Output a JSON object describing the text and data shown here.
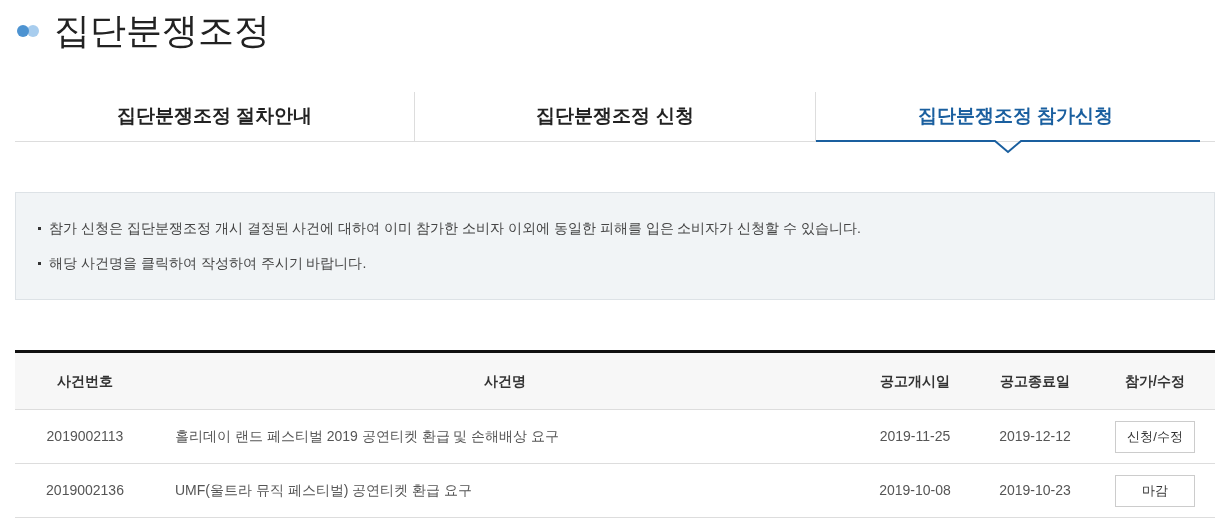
{
  "title": "집단분쟁조정",
  "tabs": [
    {
      "label": "집단분쟁조정 절차안내",
      "selected": false
    },
    {
      "label": "집단분쟁조정 신청",
      "selected": false
    },
    {
      "label": "집단분쟁조정 참가신청",
      "selected": true
    }
  ],
  "notices": [
    "참가 신청은 집단분쟁조정 개시 결정된 사건에 대하여 이미 참가한 소비자 이외에 동일한 피해를 입은 소비자가 신청할 수 있습니다.",
    "해당 사건명을 클릭하여 작성하여 주시기 바랍니다."
  ],
  "table": {
    "columns": [
      "사건번호",
      "사건명",
      "공고개시일",
      "공고종료일",
      "참가/수정"
    ],
    "rows": [
      {
        "case_number": "2019002113",
        "case_name": "홀리데이 랜드 페스티벌 2019 공연티켓 환급 및 손해배상 요구",
        "start_date": "2019-11-25",
        "end_date": "2019-12-12",
        "action": "신청/수정"
      },
      {
        "case_number": "2019002136",
        "case_name": "UMF(울트라 뮤직 페스티벌) 공연티켓 환급 요구",
        "start_date": "2019-10-08",
        "end_date": "2019-10-23",
        "action": "마감"
      }
    ]
  }
}
